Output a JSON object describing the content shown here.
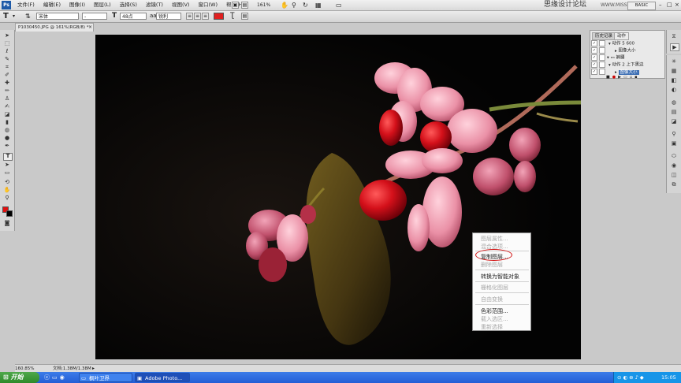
{
  "menubar": {
    "items": [
      "文件(F)",
      "编辑(E)",
      "图像(I)",
      "图层(L)",
      "选择(S)",
      "滤镜(T)",
      "视图(V)",
      "窗口(W)",
      "帮助(H)"
    ],
    "zoom": "161%",
    "workspace": "BASIC",
    "watermark": "思缘设计论坛",
    "watermark_url": "WWW.MISSYUAN.COM"
  },
  "options": {
    "tool_glyph": "T",
    "font_family": "宋体",
    "font_style": "-",
    "size_icon": "T",
    "font_size": "48点",
    "aa_icon": "aa",
    "antialias": "锐利",
    "text_color": "#e02020"
  },
  "document": {
    "tab_title": "P1030450.JPG @ 161%(RGB/8) *",
    "close_glyph": "×"
  },
  "context_menu": {
    "items": [
      {
        "label": "图层属性...",
        "disabled": true
      },
      {
        "label": "混合选项...",
        "disabled": true
      },
      {
        "label": "复制图层...",
        "disabled": false
      },
      {
        "label": "删除图层",
        "disabled": true
      },
      {
        "label": "转换为智能对象",
        "disabled": false
      },
      {
        "label": "栅格化图层",
        "disabled": true
      },
      {
        "label": "自由变换",
        "disabled": true
      },
      {
        "label": "色彩范围...",
        "disabled": false
      },
      {
        "label": "载入选区...",
        "disabled": true
      },
      {
        "label": "重新选择",
        "disabled": true
      }
    ]
  },
  "actions_panel": {
    "tabs": [
      "历史记录",
      "动作"
    ],
    "rows": [
      {
        "label": "动作 5  600",
        "highlight": false
      },
      {
        "label": "图像大小",
        "highlight": false
      },
      {
        "label": "裤腰",
        "highlight": false
      },
      {
        "label": "动作 2  上下黑边",
        "highlight": false
      },
      {
        "label": "图像大小",
        "highlight": true
      }
    ]
  },
  "status": {
    "zoom": "160.85%",
    "doc_size": "文档:1.38M/1.38M"
  },
  "taskbar": {
    "start_label": "开始",
    "tasks": [
      "枫叶卫界",
      "Adobe Photo..."
    ],
    "clock": "15:05"
  },
  "colors": {
    "foreground": "#e01010",
    "background": "#000000"
  }
}
